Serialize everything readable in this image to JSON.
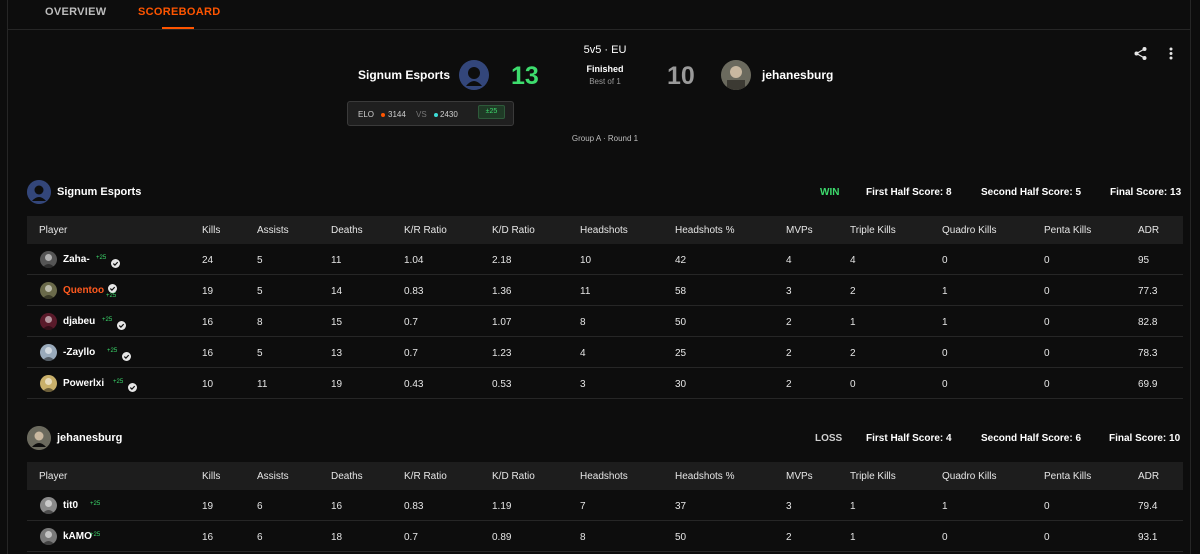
{
  "tabs": [
    {
      "label": "OVERVIEW"
    },
    {
      "label": "SCOREBOARD"
    }
  ],
  "match": {
    "format": "5v5 · EU",
    "status": "Finished",
    "best_of": "Best of 1",
    "stage": "Group A · Round 1",
    "team1": {
      "name": "Signum Esports",
      "score": "13",
      "score_color": "#3ddc6d"
    },
    "team2": {
      "name": "jehanesburg",
      "score": "10",
      "score_color": "#9a9a9a"
    },
    "elo": {
      "label": "ELO",
      "team1": "3144",
      "vs": "VS",
      "team2": "2430",
      "gain": "±25",
      "team1_color": "#ff5500",
      "team2_color": "#3ddcd6"
    }
  },
  "icons": {
    "share": "share-icon",
    "more": "more-vertical-icon",
    "verified": "verified-check-icon"
  },
  "columns": [
    "Player",
    "Kills",
    "Assists",
    "Deaths",
    "K/R Ratio",
    "K/D Ratio",
    "Headshots",
    "Headshots %",
    "MVPs",
    "Triple Kills",
    "Quadro Kills",
    "Penta Kills",
    "ADR"
  ],
  "teams": [
    {
      "name": "Signum Esports",
      "result": "WIN",
      "result_color": "#3ddc6d",
      "first_half": "First Half Score: 8",
      "second_half": "Second Half Score: 5",
      "final": "Final Score: 13",
      "players": [
        {
          "name": "Zaha-",
          "elo": "+25",
          "name_color": "#ffffff",
          "stats": [
            "24",
            "5",
            "11",
            "1.04",
            "2.18",
            "10",
            "42",
            "4",
            "4",
            "0",
            "0",
            "95"
          ]
        },
        {
          "name": "Quentoo",
          "elo": "+25",
          "name_color": "#ff5a1f",
          "stats": [
            "19",
            "5",
            "14",
            "0.83",
            "1.36",
            "11",
            "58",
            "3",
            "2",
            "1",
            "0",
            "77.3"
          ]
        },
        {
          "name": "djabeu",
          "elo": "+25",
          "name_color": "#ffffff",
          "stats": [
            "16",
            "8",
            "15",
            "0.7",
            "1.07",
            "8",
            "50",
            "2",
            "1",
            "1",
            "0",
            "82.8"
          ]
        },
        {
          "name": "-Zayllo",
          "elo": "+25",
          "name_color": "#ffffff",
          "stats": [
            "16",
            "5",
            "13",
            "0.7",
            "1.23",
            "4",
            "25",
            "2",
            "2",
            "0",
            "0",
            "78.3"
          ]
        },
        {
          "name": "Powerlxi",
          "elo": "+25",
          "name_color": "#ffffff",
          "stats": [
            "10",
            "11",
            "19",
            "0.43",
            "0.53",
            "3",
            "30",
            "2",
            "0",
            "0",
            "0",
            "69.9"
          ]
        }
      ]
    },
    {
      "name": "jehanesburg",
      "result": "LOSS",
      "result_color": "#cfcfcf",
      "first_half": "First Half Score: 4",
      "second_half": "Second Half Score: 6",
      "final": "Final Score: 10",
      "players": [
        {
          "name": "tit0",
          "elo": "+25",
          "name_color": "#ffffff",
          "stats": [
            "19",
            "6",
            "16",
            "0.83",
            "1.19",
            "7",
            "37",
            "3",
            "1",
            "1",
            "0",
            "79.4"
          ]
        },
        {
          "name": "kAMO",
          "elo": "+25",
          "name_color": "#ffffff",
          "stats": [
            "16",
            "6",
            "18",
            "0.7",
            "0.89",
            "8",
            "50",
            "2",
            "1",
            "0",
            "0",
            "93.1"
          ]
        }
      ]
    }
  ]
}
